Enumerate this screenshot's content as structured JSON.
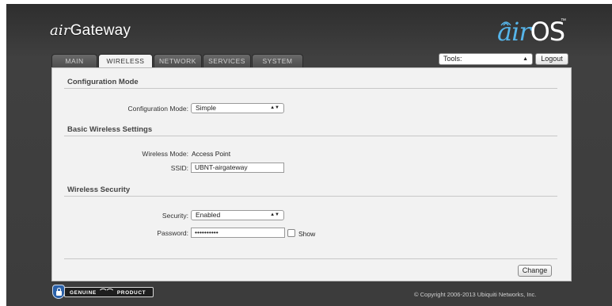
{
  "header": {
    "brand_prefix": "air",
    "brand_name": "Gateway",
    "logo_prefix": "air",
    "logo_name": "OS",
    "logo_tm": "™"
  },
  "tabs": [
    {
      "label": "MAIN",
      "active": false
    },
    {
      "label": "WIRELESS",
      "active": true
    },
    {
      "label": "NETWORK",
      "active": false
    },
    {
      "label": "SERVICES",
      "active": false
    },
    {
      "label": "SYSTEM",
      "active": false
    }
  ],
  "toolbar": {
    "tools_value": "Tools:",
    "logout_label": "Logout"
  },
  "configuration_mode": {
    "title": "Configuration Mode",
    "mode_label": "Configuration Mode:",
    "mode_value": "Simple"
  },
  "basic_wireless": {
    "title": "Basic Wireless Settings",
    "wireless_mode_label": "Wireless Mode:",
    "wireless_mode_value": "Access Point",
    "ssid_label": "SSID:",
    "ssid_value": "UBNT-airgateway"
  },
  "wireless_security": {
    "title": "Wireless Security",
    "security_label": "Security:",
    "security_value": "Enabled",
    "password_label": "Password:",
    "password_value": "••••••••••",
    "show_label": "Show"
  },
  "actions": {
    "change_label": "Change"
  },
  "footer": {
    "badge_left": "GENUINE",
    "badge_right": "PRODUCT",
    "copyright": "© Copyright 2006-2013 Ubiquiti Networks, Inc."
  },
  "colors": {
    "frame_background": "#3c3c3c",
    "panel_background": "#f2f2f2",
    "logo_accent": "#56b5ea",
    "badge_blue": "#2b61a8"
  }
}
